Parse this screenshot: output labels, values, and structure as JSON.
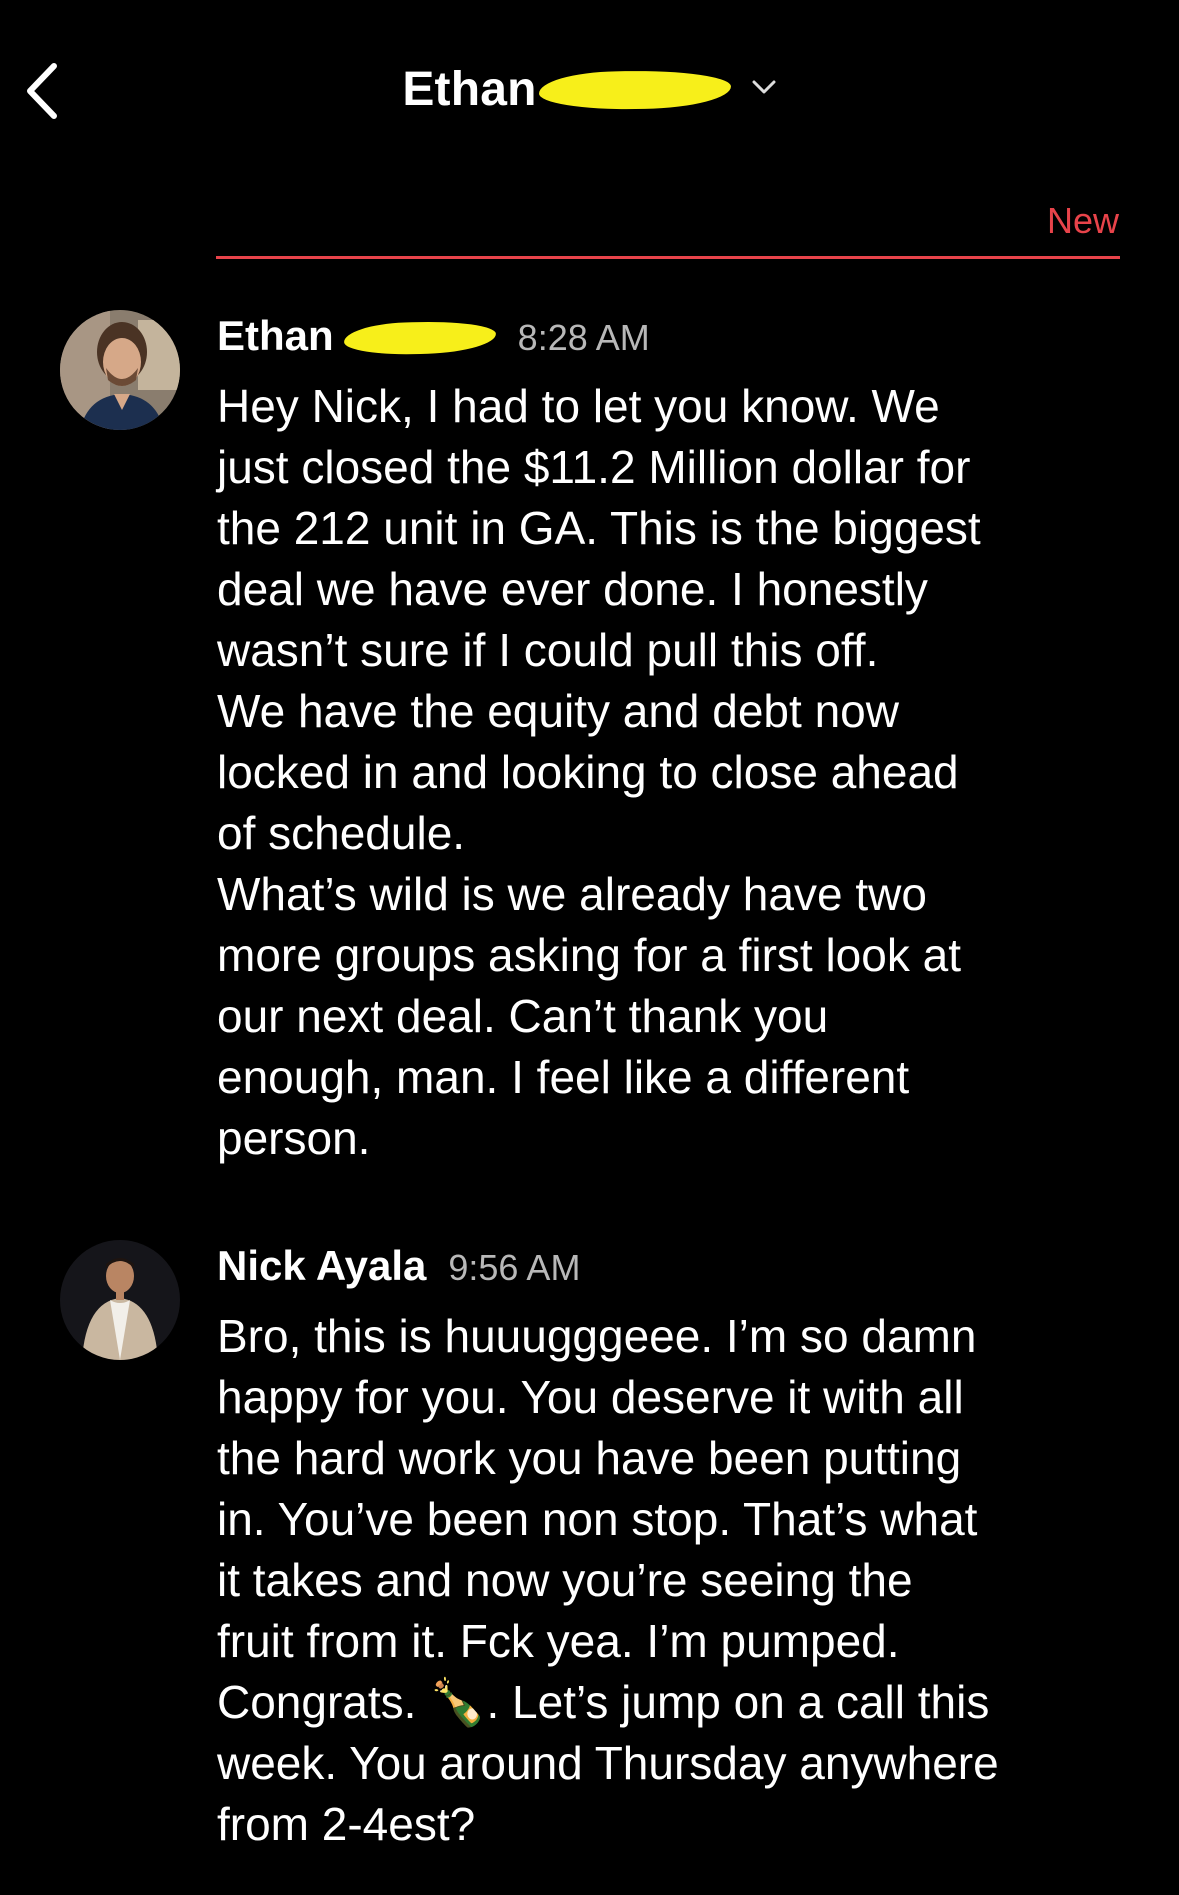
{
  "header": {
    "contact_name": "Ethan"
  },
  "divider": {
    "new_label": "New"
  },
  "messages": [
    {
      "sender": "Ethan",
      "time": "8:28 AM",
      "text": "Hey Nick, I had to let you know. We\njust closed the $11.2 Million dollar for\nthe 212 unit in GA. This is the biggest\ndeal we have ever done. I honestly\nwasn’t sure if I could pull this off.\nWe have the equity and debt now\nlocked in and looking to close ahead\nof schedule.\nWhat’s wild is we already have two\nmore groups asking for a first look at\nour next deal. Can’t thank you\nenough, man. I feel like a different\nperson."
    },
    {
      "sender": "Nick Ayala",
      "time": "9:56 AM",
      "text": "Bro, this is huuugggeee. I’m so damn\nhappy for you. You deserve it with all\nthe hard work you have been putting\nin. You’ve been non stop. That’s what\nit takes and now you’re seeing the\nfruit from it. Fck yea. I’m pumped.\nCongrats. 🍾. Let’s jump on a call this\nweek. You around Thursday anywhere\nfrom 2-4est?"
    }
  ],
  "colors": {
    "background": "#000000",
    "accent_red": "#e8434a",
    "redaction_yellow": "#f7ef1a",
    "timestamp_gray": "#b8b8b8"
  },
  "icons": {
    "back": "chevron-left-icon",
    "dropdown": "chevron-down-icon"
  }
}
